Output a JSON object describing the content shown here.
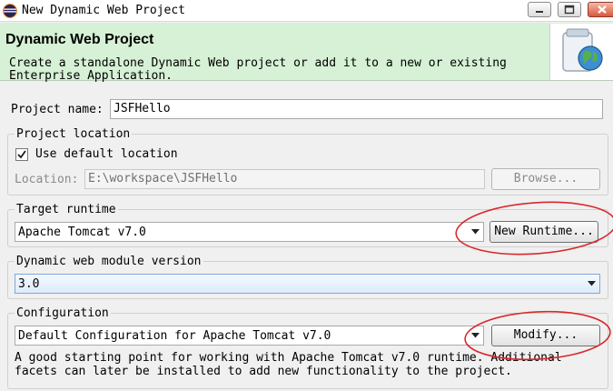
{
  "window": {
    "title": "New Dynamic Web Project"
  },
  "header": {
    "title": "Dynamic Web Project",
    "description": "Create a standalone Dynamic Web project or add it to a new or existing Enterprise Application."
  },
  "project_name": {
    "label": "Project name:",
    "value": "JSFHello"
  },
  "project_location": {
    "group_label": "Project location",
    "use_default_label": "Use default location",
    "use_default_checked": true,
    "location_label": "Location:",
    "location_value": "E:\\workspace\\JSFHello",
    "browse_label": "Browse..."
  },
  "target_runtime": {
    "group_label": "Target runtime",
    "selected": "Apache Tomcat v7.0",
    "new_runtime_label": "New Runtime..."
  },
  "module_version": {
    "group_label": "Dynamic web module version",
    "selected": "3.0"
  },
  "configuration": {
    "group_label": "Configuration",
    "selected": "Default Configuration for Apache Tomcat v7.0",
    "modify_label": "Modify...",
    "description": "A good starting point for working with Apache Tomcat v7.0 runtime. Additional facets can later be installed to add new functionality to the project."
  },
  "colors": {
    "header_bg": "#d6f1d6",
    "annotation_red": "#d9282c",
    "selected_combo_bg": "#dcebfb"
  }
}
